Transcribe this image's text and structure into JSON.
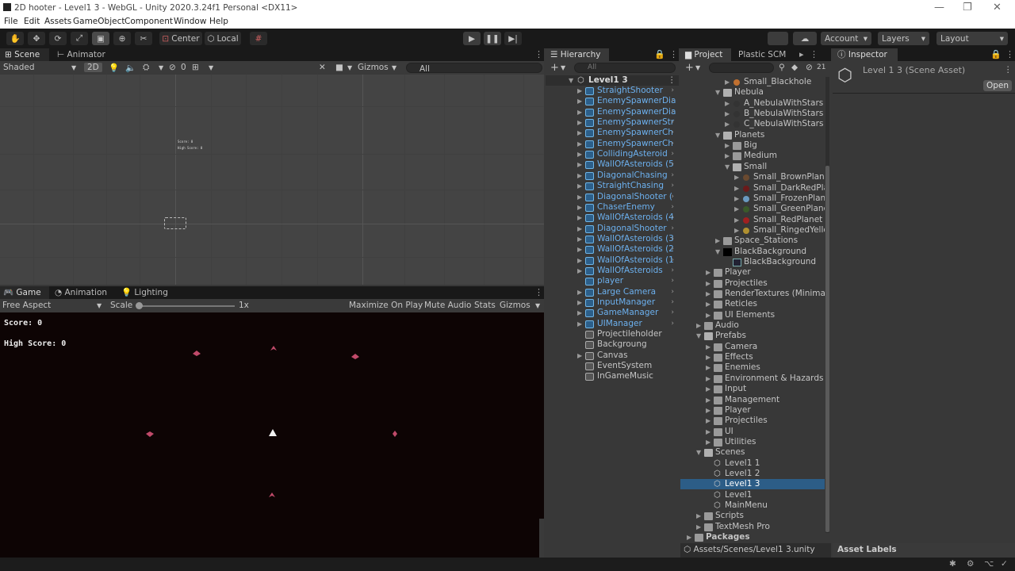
{
  "window": {
    "title": "2D hooter - Level1 3 - WebGL - Unity 2020.3.24f1 Personal <DX11>"
  },
  "menu": [
    "File",
    "Edit",
    "Assets",
    "GameObject",
    "Component",
    "Window",
    "Help"
  ],
  "toolbar": {
    "center_label": "Center",
    "local_label": "Local",
    "account_label": "Account",
    "layers_label": "Layers",
    "layout_label": "Layout"
  },
  "scene": {
    "tabs": [
      "Scene",
      "Animator"
    ],
    "shading": "Shaded",
    "mode_2d": "2D",
    "hidden_count": "0",
    "gizmos_label": "Gizmos",
    "search_placeholder": "All",
    "mini_score": "Score: 0",
    "mini_high": "High Score: 0"
  },
  "game": {
    "tabs": [
      "Game",
      "Animation",
      "Lighting"
    ],
    "aspect": "Free Aspect",
    "scale_label": "Scale",
    "scale_value": "1x",
    "maximize": "Maximize On Play",
    "mute": "Mute Audio",
    "stats": "Stats",
    "gizmos": "Gizmos",
    "score": "Score: 0",
    "high_score": "High Score: 0"
  },
  "hierarchy": {
    "tab": "Hierarchy",
    "search_placeholder": "All",
    "scene_name": "Level1 3",
    "items": [
      {
        "label": "StraightShooter",
        "prefab": true,
        "arrow": true
      },
      {
        "label": "EnemySpawnerDia",
        "prefab": true,
        "arrow": true
      },
      {
        "label": "EnemySpawnerDia",
        "prefab": true,
        "arrow": true
      },
      {
        "label": "EnemySpawnerStr",
        "prefab": true,
        "arrow": true
      },
      {
        "label": "EnemySpawnerCh",
        "prefab": true,
        "arrow": true
      },
      {
        "label": "EnemySpawnerCh",
        "prefab": true,
        "arrow": true
      },
      {
        "label": "CollidingAsteroid",
        "prefab": true,
        "arrow": true
      },
      {
        "label": "WallOfAsteroids (5",
        "prefab": true,
        "arrow": true
      },
      {
        "label": "DiagonalChasing",
        "prefab": true,
        "arrow": true
      },
      {
        "label": "StraightChasing",
        "prefab": true,
        "arrow": true
      },
      {
        "label": "DiagonalShooter (",
        "prefab": true,
        "arrow": true
      },
      {
        "label": "ChaserEnemy",
        "prefab": true,
        "arrow": true
      },
      {
        "label": "WallOfAsteroids (4",
        "prefab": true,
        "arrow": true
      },
      {
        "label": "DiagonalShooter",
        "prefab": true,
        "arrow": true
      },
      {
        "label": "WallOfAsteroids (3",
        "prefab": true,
        "arrow": true
      },
      {
        "label": "WallOfAsteroids (2",
        "prefab": true,
        "arrow": true
      },
      {
        "label": "WallOfAsteroids (1",
        "prefab": true,
        "arrow": true
      },
      {
        "label": "WallOfAsteroids",
        "prefab": true,
        "arrow": true
      },
      {
        "label": "player",
        "prefab": true,
        "arrow": false
      },
      {
        "label": "Large Camera",
        "prefab": true,
        "arrow": true
      },
      {
        "label": "InputManager",
        "prefab": true,
        "arrow": true
      },
      {
        "label": "GameManager",
        "prefab": true,
        "arrow": true
      },
      {
        "label": "UIManager",
        "prefab": true,
        "arrow": true
      },
      {
        "label": "Projectileholder",
        "prefab": false,
        "arrow": false
      },
      {
        "label": "Backgroung",
        "prefab": false,
        "arrow": false
      },
      {
        "label": "Canvas",
        "prefab": false,
        "arrow": true
      },
      {
        "label": "EventSystem",
        "prefab": false,
        "arrow": false
      },
      {
        "label": "InGameMusic",
        "prefab": false,
        "arrow": false
      }
    ]
  },
  "project": {
    "tabs": [
      "Project",
      "Plastic SCM"
    ],
    "search_placeholder": "",
    "badge": "21",
    "path": "Assets/Scenes/Level1 3.unity",
    "items": [
      {
        "label": "Small_Blackhole",
        "indent": 3,
        "type": "planet",
        "color": "#c07030"
      },
      {
        "label": "Nebula",
        "indent": 2,
        "type": "folder-open"
      },
      {
        "label": "A_NebulaWithStars",
        "indent": 3,
        "type": "planet",
        "color": "#333"
      },
      {
        "label": "B_NebulaWithStars",
        "indent": 3,
        "type": "planet",
        "color": "#333"
      },
      {
        "label": "C_NebulaWithStars",
        "indent": 3,
        "type": "planet",
        "color": "#333"
      },
      {
        "label": "Planets",
        "indent": 2,
        "type": "folder-open"
      },
      {
        "label": "Big",
        "indent": 3,
        "type": "folder"
      },
      {
        "label": "Medium",
        "indent": 3,
        "type": "folder"
      },
      {
        "label": "Small",
        "indent": 3,
        "type": "folder-open"
      },
      {
        "label": "Small_BrownPlanet",
        "indent": 4,
        "type": "planet",
        "color": "#6a4a30"
      },
      {
        "label": "Small_DarkRedPlan",
        "indent": 4,
        "type": "planet",
        "color": "#6a1a1a"
      },
      {
        "label": "Small_FrozenPlanet",
        "indent": 4,
        "type": "planet",
        "color": "#6a9ac0"
      },
      {
        "label": "Small_GreenPlanet",
        "indent": 4,
        "type": "planet",
        "color": "#3a5a2a"
      },
      {
        "label": "Small_RedPlanet",
        "indent": 4,
        "type": "planet",
        "color": "#a02020"
      },
      {
        "label": "Small_RingedYellow",
        "indent": 4,
        "type": "planet",
        "color": "#b09030"
      },
      {
        "label": "Space_Stations",
        "indent": 2,
        "type": "folder"
      },
      {
        "label": "BlackBackground",
        "indent": 2,
        "type": "black",
        "open": true
      },
      {
        "label": "BlackBackground",
        "indent": 3,
        "type": "sprite"
      },
      {
        "label": "Player",
        "indent": 1,
        "type": "folder"
      },
      {
        "label": "Projectiles",
        "indent": 1,
        "type": "folder"
      },
      {
        "label": "RenderTextures (Minimaps",
        "indent": 1,
        "type": "folder"
      },
      {
        "label": "Reticles",
        "indent": 1,
        "type": "folder"
      },
      {
        "label": "UI Elements",
        "indent": 1,
        "type": "folder"
      },
      {
        "label": "Audio",
        "indent": 0,
        "type": "folder"
      },
      {
        "label": "Prefabs",
        "indent": 0,
        "type": "folder-open"
      },
      {
        "label": "Camera",
        "indent": 1,
        "type": "folder"
      },
      {
        "label": "Effects",
        "indent": 1,
        "type": "folder"
      },
      {
        "label": "Enemies",
        "indent": 1,
        "type": "folder"
      },
      {
        "label": "Environment & Hazards",
        "indent": 1,
        "type": "folder"
      },
      {
        "label": "Input",
        "indent": 1,
        "type": "folder"
      },
      {
        "label": "Management",
        "indent": 1,
        "type": "folder"
      },
      {
        "label": "Player",
        "indent": 1,
        "type": "folder"
      },
      {
        "label": "Projectiles",
        "indent": 1,
        "type": "folder"
      },
      {
        "label": "UI",
        "indent": 1,
        "type": "folder"
      },
      {
        "label": "Utilities",
        "indent": 1,
        "type": "folder"
      },
      {
        "label": "Scenes",
        "indent": 0,
        "type": "folder-open"
      },
      {
        "label": "Level1 1",
        "indent": 1,
        "type": "scene"
      },
      {
        "label": "Level1 2",
        "indent": 1,
        "type": "scene"
      },
      {
        "label": "Level1 3",
        "indent": 1,
        "type": "scene",
        "selected": true
      },
      {
        "label": "Level1",
        "indent": 1,
        "type": "scene"
      },
      {
        "label": "MainMenu",
        "indent": 1,
        "type": "scene"
      },
      {
        "label": "Scripts",
        "indent": 0,
        "type": "folder"
      },
      {
        "label": "TextMesh Pro",
        "indent": 0,
        "type": "folder"
      },
      {
        "label": "Packages",
        "indent": -1,
        "type": "folder",
        "bold": true
      }
    ]
  },
  "inspector": {
    "tab": "Inspector",
    "asset_title": "Level 1 3 (Scene Asset)",
    "open_button": "Open",
    "asset_labels": "Asset Labels"
  },
  "colors": {
    "accent": "#2c5d87",
    "prefab_text": "#6cb0ee",
    "game_bg": "#0d0404"
  }
}
